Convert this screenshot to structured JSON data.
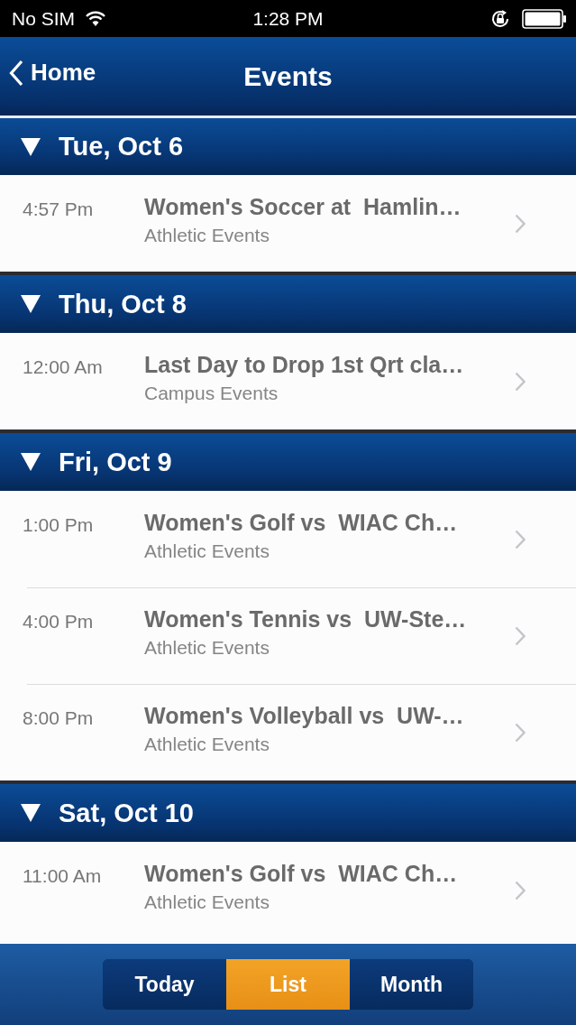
{
  "status_bar": {
    "carrier": "No SIM",
    "time": "1:28 PM"
  },
  "nav": {
    "back": "Home",
    "title": "Events"
  },
  "sections": [
    {
      "date": "Tue, Oct 6",
      "expanded": true,
      "events": [
        {
          "time": "4:57 Pm",
          "title": "Women's Soccer at  Hamlin…",
          "category": "Athletic Events"
        }
      ]
    },
    {
      "date": "Thu, Oct 8",
      "expanded": true,
      "events": [
        {
          "time": "12:00 Am",
          "title": "Last Day to Drop 1st Qrt cla…",
          "category": "Campus Events"
        }
      ]
    },
    {
      "date": "Fri, Oct 9",
      "expanded": true,
      "events": [
        {
          "time": "1:00 Pm",
          "title": "Women's Golf vs  WIAC Ch…",
          "category": "Athletic Events"
        },
        {
          "time": "4:00 Pm",
          "title": "Women's Tennis vs  UW-Ste…",
          "category": "Athletic Events"
        },
        {
          "time": "8:00 Pm",
          "title": "Women's Volleyball vs  UW-…",
          "category": "Athletic Events"
        }
      ]
    },
    {
      "date": "Sat, Oct 10",
      "expanded": true,
      "events": [
        {
          "time": "11:00 Am",
          "title": "Women's Golf vs  WIAC Ch…",
          "category": "Athletic Events"
        }
      ]
    }
  ],
  "tabs": [
    {
      "label": "Today",
      "selected": false
    },
    {
      "label": "List",
      "selected": true
    },
    {
      "label": "Month",
      "selected": false
    }
  ]
}
